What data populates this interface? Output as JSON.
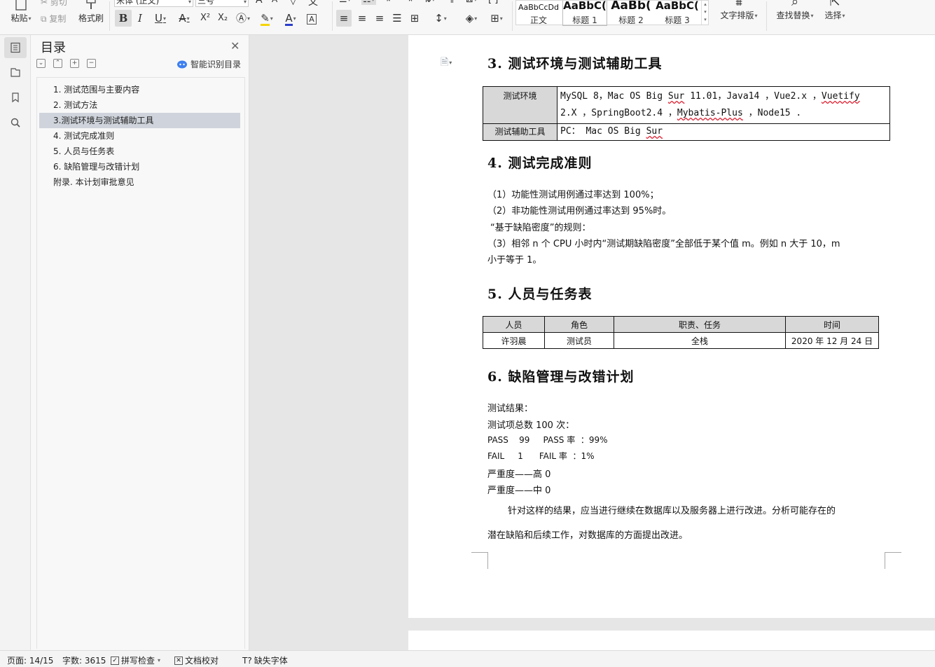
{
  "ribbon": {
    "paste_label": "粘贴",
    "cut_label": "剪切",
    "copy_label": "复制",
    "format_painter_label": "格式刷",
    "font_name": "宋体 (正文)",
    "font_size": "三号",
    "styles": [
      {
        "preview": "AaBbCcDd",
        "name": "正文"
      },
      {
        "preview": "AaBbC(",
        "name": "标题 1"
      },
      {
        "preview": "AaBb(",
        "name": "标题 2"
      },
      {
        "preview": "AaBbC(",
        "name": "标题 3"
      }
    ],
    "text_layout_label": "文字排版",
    "find_replace_label": "查找替换",
    "select_label": "选择",
    "bold_glyph": "B",
    "italic_glyph": "I",
    "underline_glyph": "U",
    "strike_glyph": "A",
    "superscript_glyph": "X²",
    "subscript_glyph": "X₂",
    "font_color_glyph": "A",
    "char_border_glyph": "A",
    "font_color": "#2b3fcc",
    "highlight_color": "#f5d400"
  },
  "toc": {
    "title": "目录",
    "smart_label": "智能识别目录",
    "items": [
      {
        "label": "1.  测试范围与主要内容"
      },
      {
        "label": "2.  测试方法"
      },
      {
        "label": "3.测试环境与测试辅助工具"
      },
      {
        "label": "4.  测试完成准则"
      },
      {
        "label": "5.  人员与任务表"
      },
      {
        "label": "6.  缺陷管理与改错计划"
      },
      {
        "label": "附录. 本计划审批意见"
      }
    ]
  },
  "doc": {
    "h3": "3.  测试环境与测试辅助工具",
    "env_table": {
      "row1_label": "测试环境",
      "row1_line1_a": "MySQL 8，Mac OS Big ",
      "row1_line1_b": "Sur",
      "row1_line1_c": " 11.01，Java14 ，Vue2.x ，",
      "row1_line1_d": "Vuetify",
      "row1_line2_a": "2.X ，SpringBoot2.4 ，",
      "row1_line2_b": "Mybatis-Plus",
      "row1_line2_c": " ，Node15 .",
      "row2_label": "测试辅助工具",
      "row2_a": "PC： Mac OS Big ",
      "row2_b": "Sur"
    },
    "h4": "4.  测试完成准则",
    "criteria": [
      "（1）功能性测试用例通过率达到 100%；",
      "（2）非功能性测试用例通过率达到 95%时。",
      "“基于缺陷密度”的规则：",
      "（3）相邻 n 个 CPU 小时内“测试期缺陷密度”全部低于某个值 m。例如 n 大于 10，m",
      "小于等于 1。"
    ],
    "h5": "5.  人员与任务表",
    "staff_table": {
      "headers": [
        "人员",
        "角色",
        "职责、任务",
        "时间"
      ],
      "row": [
        "许羽晨",
        "测试员",
        "全栈",
        "2020 年 12 月 24 日"
      ]
    },
    "h6": "6.  缺陷管理与改错计划",
    "results": [
      "测试结果：",
      "测试项总数 100 次：",
      "PASS    99     PASS 率  ：99%",
      "FAIL     1      FAIL 率  ：1%",
      "严重度——高  0",
      "严重度——中  0"
    ],
    "conclusion_line1": "针对这样的结果，应当进行继续在数据库以及服务器上进行改进。分析可能存在的",
    "conclusion_line2": "潜在缺陷和后续工作，对数据库的方面提出改进。"
  },
  "status": {
    "page": "页面: 14/15",
    "words": "字数: 3615",
    "spell_check": "拼写检查",
    "doc_proof": "文档校对",
    "missing_font": "缺失字体"
  }
}
